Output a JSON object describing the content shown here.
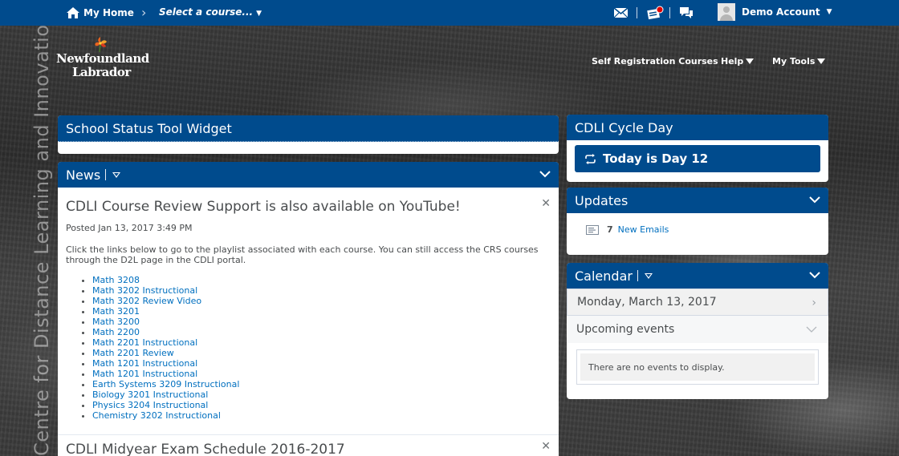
{
  "topbar": {
    "home_label": "My Home",
    "course_selector": "Select a course...",
    "account_name": "Demo Account"
  },
  "logo": {
    "line1": "Newfoundland",
    "line2": "Labrador"
  },
  "vertical_text": "Centre for Distance Learning and Innovation",
  "subnav": {
    "self_registration": "Self Registration Courses",
    "help": "Help",
    "my_tools": "My Tools"
  },
  "school_status": {
    "title": "School Status Tool Widget"
  },
  "news": {
    "title": "News",
    "items": [
      {
        "title": "CDLI Course Review Support is also available on YouTube!",
        "posted": "Posted Jan 13, 2017 3:49 PM",
        "description": "Click the links below to go to the playlist associated with each course. You can still access the CRS courses through the D2L page in the CDLI portal.",
        "links": [
          "Math 3208",
          "Math 3202 Instructional",
          "Math 3202 Review Video",
          "Math 3201",
          "Math 3200",
          "Math 2200",
          "Math 2201 Instructional",
          "Math 2201 Review",
          "Math 1201 Instructional",
          "Math 1201 Instructional",
          "Earth Systems 3209 Instructional",
          "Biology 3201 Instructional",
          "Physics 3204 Instructional",
          "Chemistry 3202 Instructional"
        ]
      },
      {
        "title": "CDLI Midyear Exam Schedule 2016-2017"
      }
    ]
  },
  "cycle_day": {
    "title": "CDLI Cycle Day",
    "label": "Today is Day 12"
  },
  "updates": {
    "title": "Updates",
    "count": "7",
    "label": "New Emails"
  },
  "calendar": {
    "title": "Calendar",
    "date": "Monday, March 13, 2017",
    "upcoming": "Upcoming events",
    "empty": "There are no events to display."
  },
  "colors": {
    "brand": "#004b8d",
    "link": "#006fbf",
    "text": "#494c4e",
    "notification": "#e00000"
  }
}
